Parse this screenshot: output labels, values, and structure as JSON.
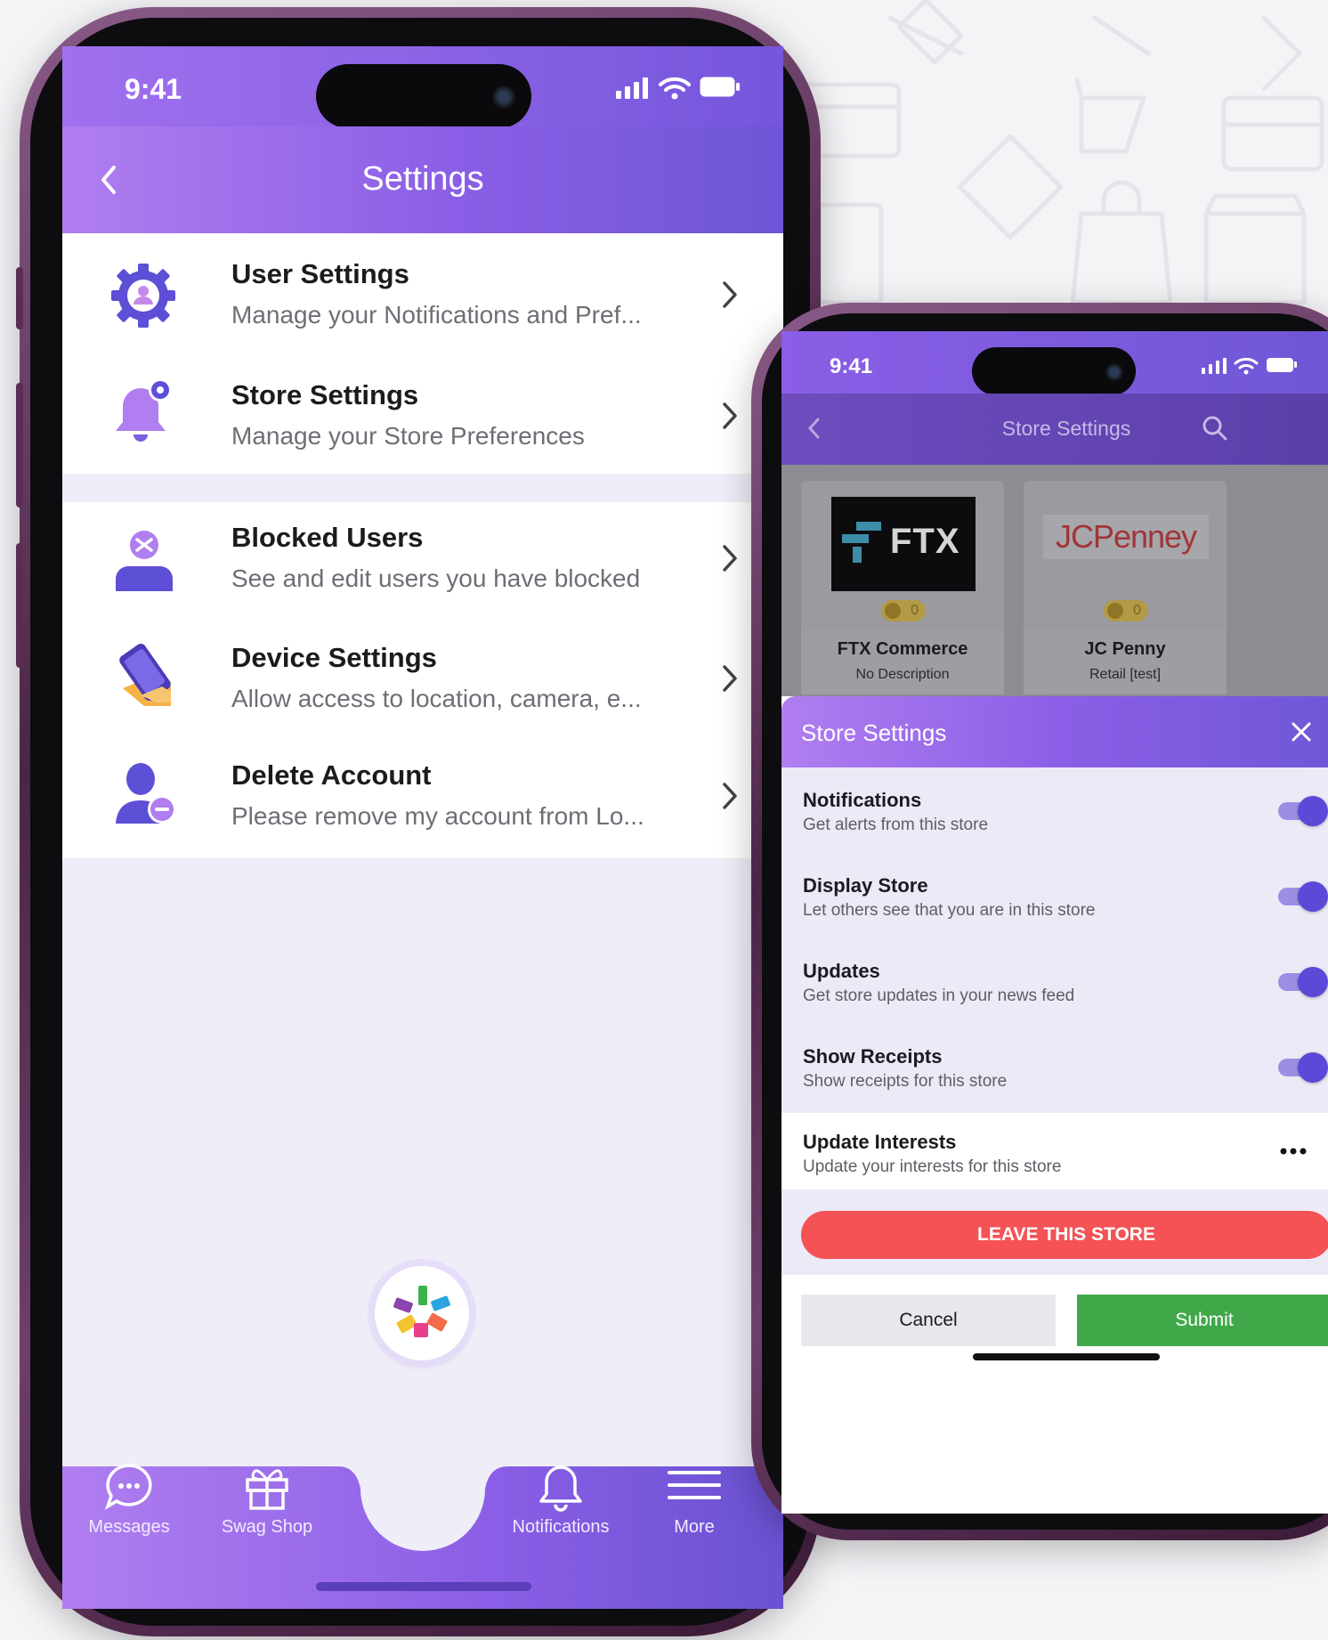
{
  "main_phone": {
    "status": {
      "time": "9:41"
    },
    "header": {
      "title": "Settings"
    },
    "settings_items": [
      {
        "title": "User Settings",
        "desc": "Manage your Notifications and Pref..."
      },
      {
        "title": "Store Settings",
        "desc": "Manage your Store Preferences"
      },
      {
        "title": "Blocked Users",
        "desc": "See and edit users you have blocked"
      },
      {
        "title": "Device Settings",
        "desc": "Allow access to location, camera, e..."
      },
      {
        "title": "Delete Account",
        "desc": "Please remove my account from Lo..."
      }
    ],
    "tabbar": {
      "messages": "Messages",
      "swag_shop": "Swag Shop",
      "notifications": "Notifications",
      "more": "More"
    }
  },
  "store_phone": {
    "status": {
      "time": "9:41"
    },
    "header": {
      "title": "Store Settings"
    },
    "stores": [
      {
        "logo": "FTX",
        "coins": "0",
        "name": "FTX Commerce",
        "desc": "No Description"
      },
      {
        "logo": "JCPenney",
        "coins": "0",
        "name": "JC Penny",
        "desc": "Retail [test]"
      }
    ],
    "sheet": {
      "title": "Store Settings",
      "toggles": [
        {
          "title": "Notifications",
          "desc": "Get alerts from this store",
          "on": true
        },
        {
          "title": "Display Store",
          "desc": "Let others see that you are in this store",
          "on": true
        },
        {
          "title": "Updates",
          "desc": "Get store updates in your news feed",
          "on": true
        },
        {
          "title": "Show Receipts",
          "desc": "Show receipts for this store",
          "on": true
        }
      ],
      "interests": {
        "title": "Update Interests",
        "desc": "Update your interests for this store"
      },
      "leave_label": "LEAVE THIS STORE",
      "cancel_label": "Cancel",
      "submit_label": "Submit"
    }
  },
  "colors": {
    "accent": "#7b5ce0",
    "danger": "#f45255",
    "success": "#41a84a"
  }
}
